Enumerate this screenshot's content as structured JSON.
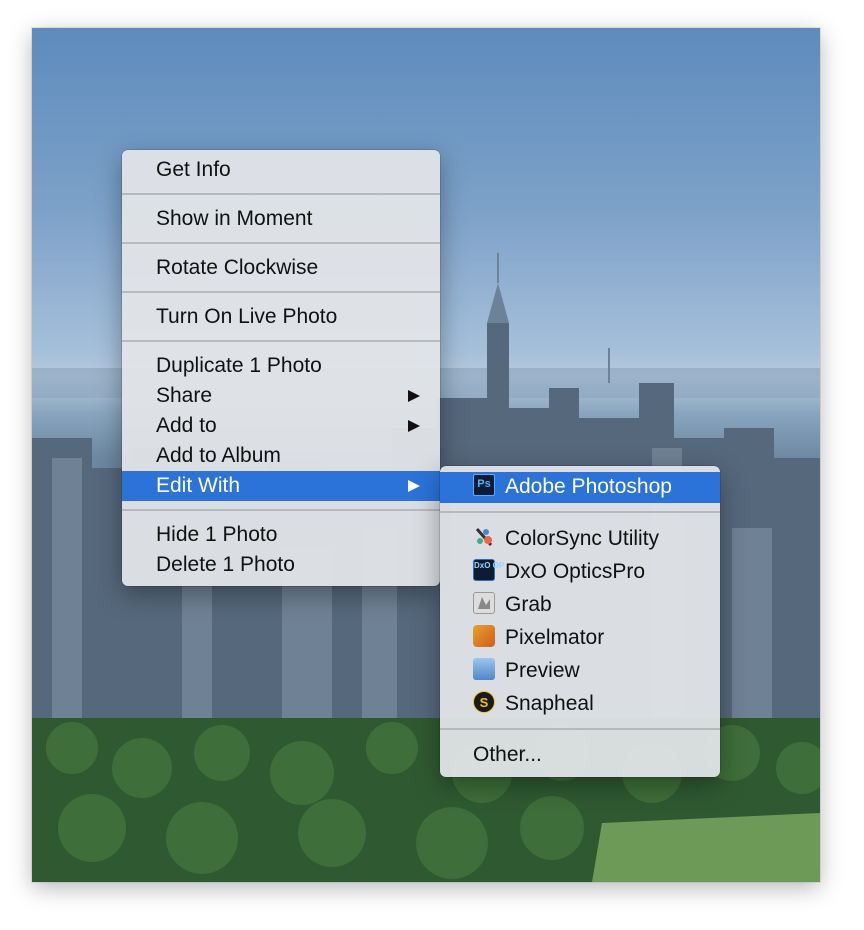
{
  "context_menu": {
    "items": [
      {
        "label": "Get Info"
      },
      {
        "label": "Show in Moment"
      },
      {
        "label": "Rotate Clockwise"
      },
      {
        "label": "Turn On Live Photo"
      },
      {
        "label": "Duplicate 1 Photo"
      },
      {
        "label": "Share",
        "has_submenu": true
      },
      {
        "label": "Add to",
        "has_submenu": true
      },
      {
        "label": "Add to Album"
      },
      {
        "label": "Edit With",
        "has_submenu": true,
        "selected": true
      },
      {
        "label": "Hide 1 Photo"
      },
      {
        "label": "Delete 1 Photo"
      }
    ]
  },
  "edit_with_submenu": {
    "items": [
      {
        "label": "Adobe Photoshop",
        "icon": "photoshop-icon",
        "icon_text": "Ps",
        "selected": true
      },
      {
        "label": "ColorSync Utility",
        "icon": "colorsync-icon"
      },
      {
        "label": "DxO OpticsPro",
        "icon": "dxo-icon",
        "icon_text": "DxO OP"
      },
      {
        "label": "Grab",
        "icon": "grab-icon"
      },
      {
        "label": "Pixelmator",
        "icon": "pixelmator-icon"
      },
      {
        "label": "Preview",
        "icon": "preview-icon"
      },
      {
        "label": "Snapheal",
        "icon": "snapheal-icon",
        "icon_text": "S"
      },
      {
        "label": "Other..."
      }
    ]
  },
  "colors": {
    "selection": "#2b73d9",
    "menu_background": "#e2e4e8"
  }
}
